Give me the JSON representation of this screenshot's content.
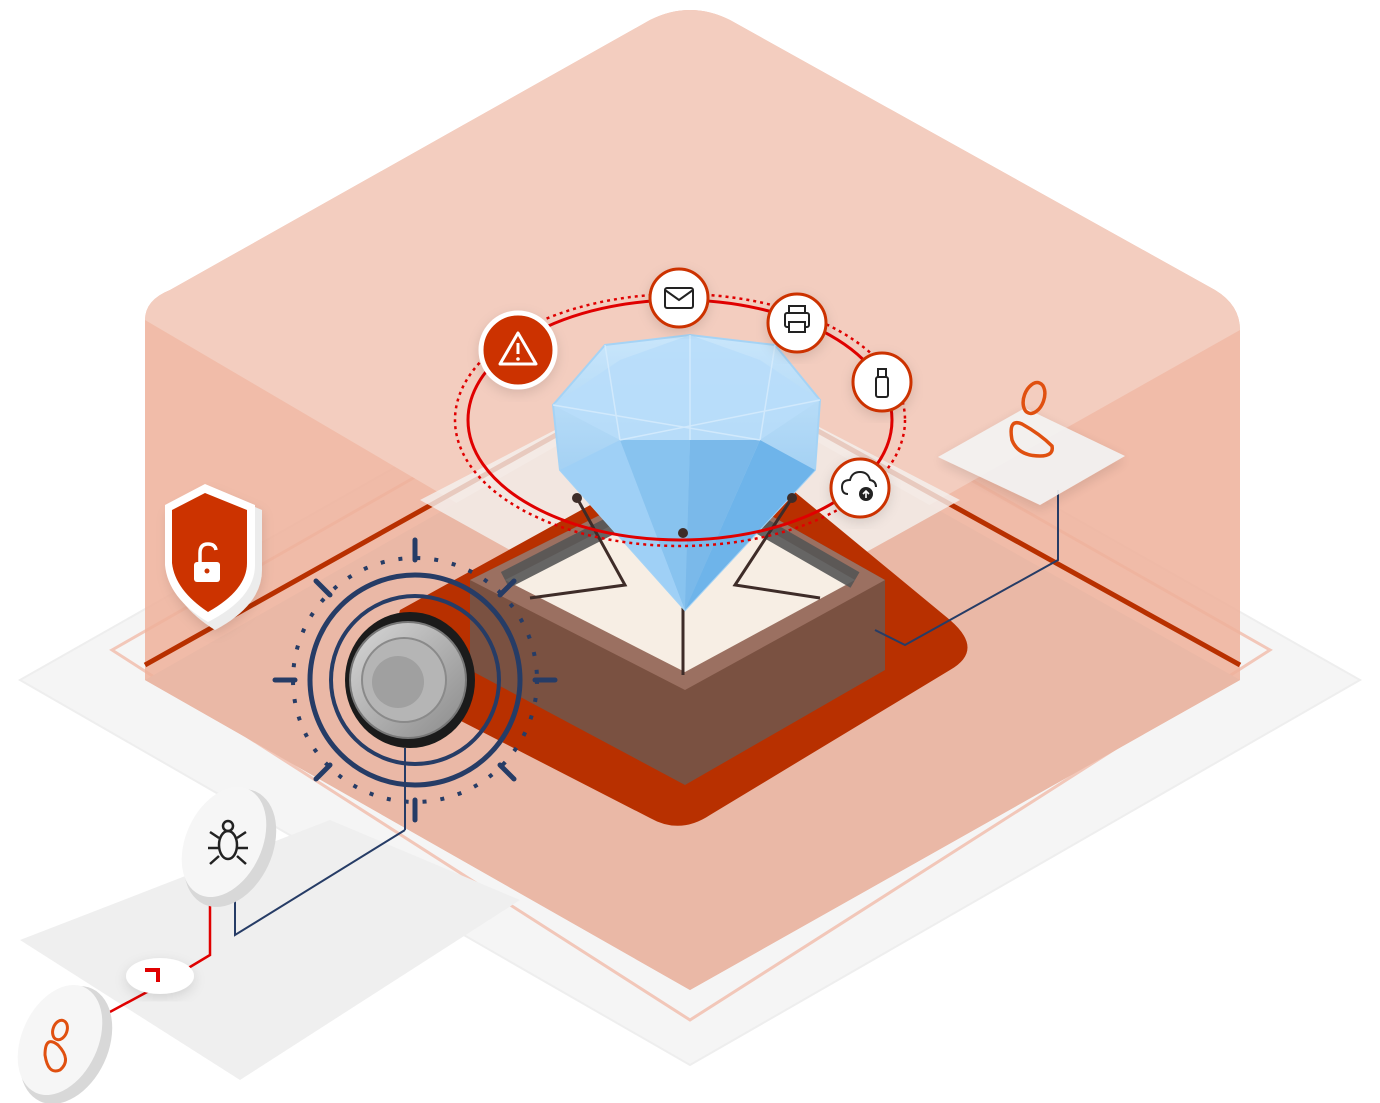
{
  "illustration": {
    "subject": "data-security-vault",
    "icons": {
      "ring_icons": [
        "warning-icon",
        "mail-icon",
        "printer-icon",
        "usb-drive-icon",
        "cloud-upload-icon"
      ],
      "side_icons": [
        "shield-unlock-icon",
        "bug-icon",
        "user-icon",
        "combination-lock-icon",
        "diamond-icon"
      ]
    },
    "colors": {
      "vault_fill": "#efa48b",
      "vault_top": "#f3cdbf",
      "accent_red": "#e00000",
      "dark_red": "#b83000",
      "pedestal": "#7a5141",
      "diamond": "#8fc7f2",
      "lock_ring": "#263c66"
    }
  }
}
